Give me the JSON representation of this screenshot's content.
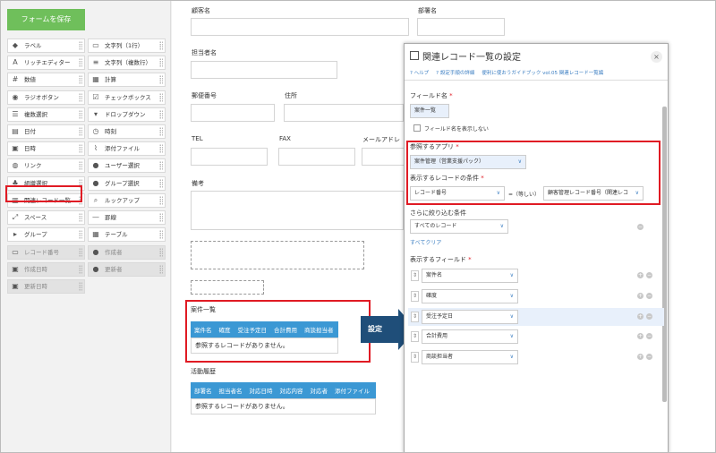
{
  "palette": {
    "save_label": "フォームを保存",
    "items": [
      {
        "label": "ラベル",
        "icon": "tag-icon"
      },
      {
        "label": "文字列（1行）",
        "icon": "text-line-icon"
      },
      {
        "label": "リッチエディター",
        "icon": "rich-editor-icon"
      },
      {
        "label": "文字列（複数行）",
        "icon": "multiline-icon"
      },
      {
        "label": "数値",
        "icon": "number-icon"
      },
      {
        "label": "計算",
        "icon": "calc-icon"
      },
      {
        "label": "ラジオボタン",
        "icon": "radio-icon"
      },
      {
        "label": "チェックボックス",
        "icon": "checkbox-icon"
      },
      {
        "label": "複数選択",
        "icon": "multiselect-icon"
      },
      {
        "label": "ドロップダウン",
        "icon": "dropdown-icon"
      },
      {
        "label": "日付",
        "icon": "date-icon"
      },
      {
        "label": "時刻",
        "icon": "clock-icon"
      },
      {
        "label": "日時",
        "icon": "datetime-icon"
      },
      {
        "label": "添付ファイル",
        "icon": "paperclip-icon"
      },
      {
        "label": "リンク",
        "icon": "globe-icon"
      },
      {
        "label": "ユーザー選択",
        "icon": "user-icon"
      },
      {
        "label": "組織選択",
        "icon": "org-icon"
      },
      {
        "label": "グループ選択",
        "icon": "group-icon"
      },
      {
        "label": "関連レコード一覧",
        "icon": "related-records-icon"
      },
      {
        "label": "ルックアップ",
        "icon": "lookup-icon"
      },
      {
        "label": "スペース",
        "icon": "space-icon"
      },
      {
        "label": "罫線",
        "icon": "rule-line-icon"
      },
      {
        "label": "グループ",
        "icon": "group-field-icon"
      },
      {
        "label": "テーブル",
        "icon": "table-icon"
      }
    ],
    "system_items": [
      {
        "label": "レコード番号",
        "icon": "record-number-icon"
      },
      {
        "label": "作成者",
        "icon": "creator-icon"
      },
      {
        "label": "作成日時",
        "icon": "created-datetime-icon"
      },
      {
        "label": "更新者",
        "icon": "updater-icon"
      },
      {
        "label": "更新日時",
        "icon": "updated-datetime-icon"
      }
    ]
  },
  "form": {
    "customer_name": "顧客名",
    "department": "部署名",
    "person_in_charge": "担当者名",
    "postal_code": "郵便番号",
    "address": "住所",
    "tel": "TEL",
    "fax": "FAX",
    "email": "メールアドレ",
    "notes": "備考",
    "related_table1": {
      "title": "案件一覧",
      "columns": [
        "案件名",
        "確度",
        "受注予定日",
        "合計費用",
        "商談担当者"
      ],
      "empty_message": "参照するレコードがありません。"
    },
    "related_table2": {
      "title": "活動履歴",
      "columns": [
        "部署名",
        "担当者名",
        "対応日時",
        "対応内容",
        "対応者",
        "添付ファイル"
      ],
      "empty_message": "参照するレコードがありません。"
    }
  },
  "arrow_label": "設定",
  "dialog": {
    "title": "関連レコード一覧の設定",
    "close": "×",
    "links": [
      "? ヘルプ",
      "? 設定手順の詳細",
      "便利に使おうガイドブック vol.05 関連レコード一覧編"
    ],
    "field_name_label": "フィールド名",
    "field_name_value": "案件一覧",
    "hide_field_name": "フィールド名を表示しない",
    "ref_app_label": "参照するアプリ",
    "ref_app_value": "案件管理（営業支援パック）",
    "condition_label": "表示するレコードの条件",
    "condition_left": "レコード番号",
    "condition_op": "=（等しい）",
    "condition_right": "顧客管理レコード番号（関連レコ",
    "filter_label": "さらに絞り込む条件",
    "filter_value": "すべてのレコード",
    "clear_all": "すべてクリア",
    "display_fields_label": "表示するフィールド",
    "display_fields": [
      "案件名",
      "確度",
      "受注予定日",
      "合計費用",
      "商談担当者"
    ],
    "required_mark": "*"
  },
  "colors": {
    "save_green": "#6fbf5b",
    "table_blue": "#3b98d4",
    "highlight_red": "#e01b24",
    "arrow_navy": "#1f4e79"
  }
}
